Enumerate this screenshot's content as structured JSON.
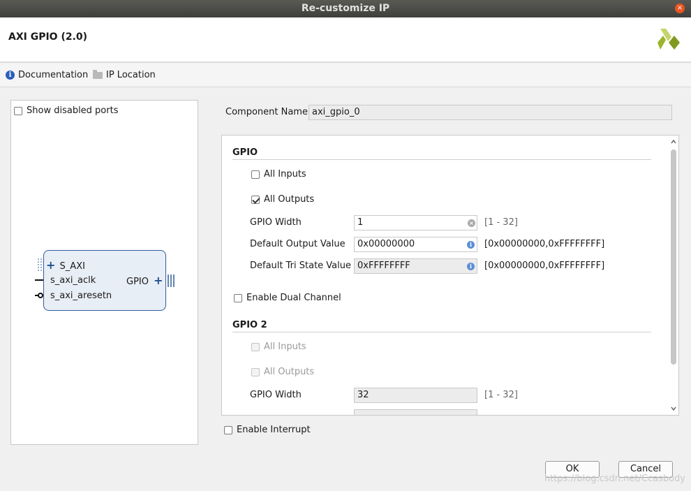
{
  "window": {
    "title": "Re-customize IP",
    "close_glyph": "×"
  },
  "header": {
    "ip_name": "AXI GPIO (2.0)"
  },
  "toolbar": {
    "documentation_label": "Documentation",
    "ip_location_label": "IP Location"
  },
  "left_panel": {
    "show_disabled_ports_label": "Show disabled ports",
    "block": {
      "bus_port": "S_AXI",
      "clk_port": "s_axi_aclk",
      "reset_port": "s_axi_aresetn",
      "gpio_port": "GPIO"
    }
  },
  "component_name": {
    "label": "Component Name",
    "value": "axi_gpio_0"
  },
  "gpio": {
    "title": "GPIO",
    "all_inputs_label": "All Inputs",
    "all_outputs_label": "All Outputs",
    "width_label": "GPIO Width",
    "width_value": "1",
    "width_range": "[1 - 32]",
    "default_output_label": "Default Output Value",
    "default_output_value": "0x00000000",
    "default_output_range": "[0x00000000,0xFFFFFFFF]",
    "tri_state_label": "Default Tri State Value",
    "tri_state_value": "0xFFFFFFFF",
    "tri_state_range": "[0x00000000,0xFFFFFFFF]"
  },
  "enable_dual_channel_label": "Enable Dual Channel",
  "gpio2": {
    "title": "GPIO 2",
    "all_inputs_label": "All Inputs",
    "all_outputs_label": "All Outputs",
    "width_label": "GPIO Width",
    "width_value": "32",
    "width_range": "[1 - 32]"
  },
  "enable_interrupt_label": "Enable Interrupt",
  "buttons": {
    "ok": "OK",
    "cancel": "Cancel"
  },
  "watermark": "https://blog.csdn.net/Ccasbody",
  "colors": {
    "accent_blue": "#2f5d9a",
    "close_orange": "#e95420",
    "logo_green": "#9bb52c"
  }
}
